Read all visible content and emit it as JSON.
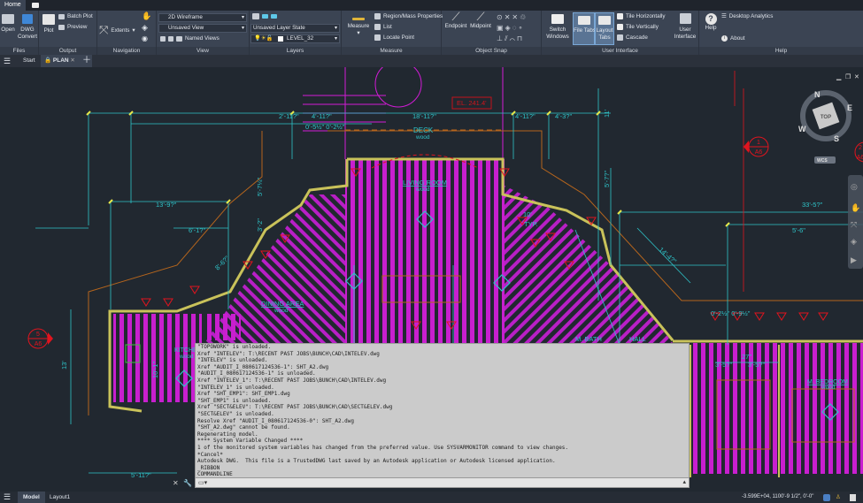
{
  "app": {
    "home_tab": "Home"
  },
  "ribbon": {
    "files": {
      "label": "Files",
      "open": "Open",
      "dwg_convert_1": "DWG",
      "dwg_convert_2": "Convert"
    },
    "output": {
      "label": "Output",
      "plot": "Plot",
      "batch_plot": "Batch Plot",
      "preview": "Preview"
    },
    "navigation": {
      "label": "Navigation",
      "extents": "Extents"
    },
    "view": {
      "label": "View",
      "visual_style": "2D Wireframe",
      "saved_view": "Unsaved View",
      "named_views": "Named Views"
    },
    "layers": {
      "label": "Layers",
      "layer_state": "Unsaved Layer State",
      "current_layer": "LEVEL_32"
    },
    "measure": {
      "label": "Measure",
      "measure": "Measure",
      "region_mass": "Region/Mass Properties",
      "list": "List",
      "locate_point": "Locate Point"
    },
    "object_snap": {
      "label": "Object Snap",
      "endpoint": "Endpoint",
      "midpoint": "Midpoint"
    },
    "user_interface": {
      "label": "User Interface",
      "switch_windows_1": "Switch",
      "switch_windows_2": "Windows",
      "file_tabs": "File Tabs",
      "layout_tabs_1": "Layout",
      "layout_tabs_2": "Tabs",
      "tile_h": "Tile Horizontally",
      "tile_v": "Tile Vertically",
      "cascade": "Cascade",
      "user_interface_1": "User",
      "user_interface_2": "Interface"
    },
    "help": {
      "label": "Help",
      "help": "Help",
      "desktop_analytics": "Desktop Analytics",
      "about": "About"
    }
  },
  "doc_tabs": {
    "start": "Start",
    "plan": "PLAN"
  },
  "viewcube": {
    "top": "TOP",
    "n": "N",
    "e": "E",
    "s": "S",
    "w": "W",
    "wcs": "WCS"
  },
  "drawing": {
    "elevation": "EL. 241.4'",
    "dims": {
      "d1": "2'-11?\"",
      "d2": "4'-11?\"",
      "d3": "18'-11?\"",
      "d4": "4'-11?\"",
      "d5": "4'-3?\"",
      "d6": "0'-5½\" 0'-2½\"",
      "d7": "13'-9?\"",
      "d8": "6'-1?\"",
      "d9": "33'-5?\"",
      "d10": "5'-6\"",
      "d11": "14'-4?\"",
      "d12": "8'-6?\"",
      "d13": "5'-7¼\"",
      "d14": "3'-2\"",
      "d15": "5'-7?\"",
      "d16": "11'",
      "d17": "13'",
      "d18": "5'-11?\"",
      "d19": "0'-2½\" 0'-9½\"",
      "d20": "3'-5?\"",
      "d21": "3'-5?\"",
      "d22": "27\"",
      "d23": "10'-1\"",
      "d24": "10'",
      "d25": "TYP."
    },
    "rooms": {
      "deck": "DECK",
      "deck_mat": "wood",
      "living": "LIVING ROOM",
      "living_mat": "wood",
      "dining": "DINING AREA",
      "dining_mat": "wood",
      "kitchen": "KITCHEN",
      "kitchen_mat": "wood",
      "mbath": "M. BATH",
      "hall": "HALL",
      "mbed": "M. BEDROOM",
      "mbed_mat": "wood"
    },
    "section_markers": [
      {
        "num": "1",
        "sheet": "A6"
      },
      {
        "num": "5",
        "sheet": "A6"
      },
      {
        "num": "2",
        "sheet": "A6"
      }
    ]
  },
  "command": {
    "lines": [
      "\"TOPOWORK\" is unloaded.",
      "Xref \"INTELEV\": T:\\RECENT PAST JOBS\\BUNCH\\CAD\\INTELEV.dwg",
      "\"INTELEV\" is unloaded.",
      "Xref \"AUDIT_I_080617124536-1\": SHT_A2.dwg",
      "\"AUDIT_I_080617124536-1\" is unloaded.",
      "Xref \"INTELEV_1\": T:\\RECENT PAST JOBS\\BUNCH\\CAD\\INTELEV.dwg",
      "\"INTELEV_1\" is unloaded.",
      "Xref \"SHT_EMP1\": SHT_EMP1.dwg",
      "\"SHT_EMP1\" is unloaded.",
      "Xref \"SECT&ELEV\": T:\\RECENT PAST JOBS\\BUNCH\\CAD\\SECT&ELEV.dwg",
      "\"SECT&ELEV\" is unloaded.",
      "Resolve Xref \"AUDIT_I_080617124536-0\": SHT_A2.dwg",
      "\"SHT_A2.dwg\" cannot be found.",
      "Regenerating model.",
      "**** System Variable Changed ****",
      "1 of the monitored system variables has changed from the preferred value. Use SYSVARMONITOR command to view changes.",
      "*Cancel*",
      "Autodesk DWG.  This file is a TrustedDWG last saved by an Autodesk application or Autodesk licensed application.",
      "_RIBBON",
      "COMMANDLINE"
    ],
    "input_value": ""
  },
  "status": {
    "model": "Model",
    "layout1": "Layout1",
    "coords": "-3.599E+04, 1100'-9 1/2\", 0'-0\""
  },
  "colors": {
    "background": "#212830",
    "ribbon": "#3b4453",
    "cyan": "#2ec4c9",
    "magenta": "#d21bd6",
    "red": "#e0141e",
    "yellow": "#d8d860"
  }
}
